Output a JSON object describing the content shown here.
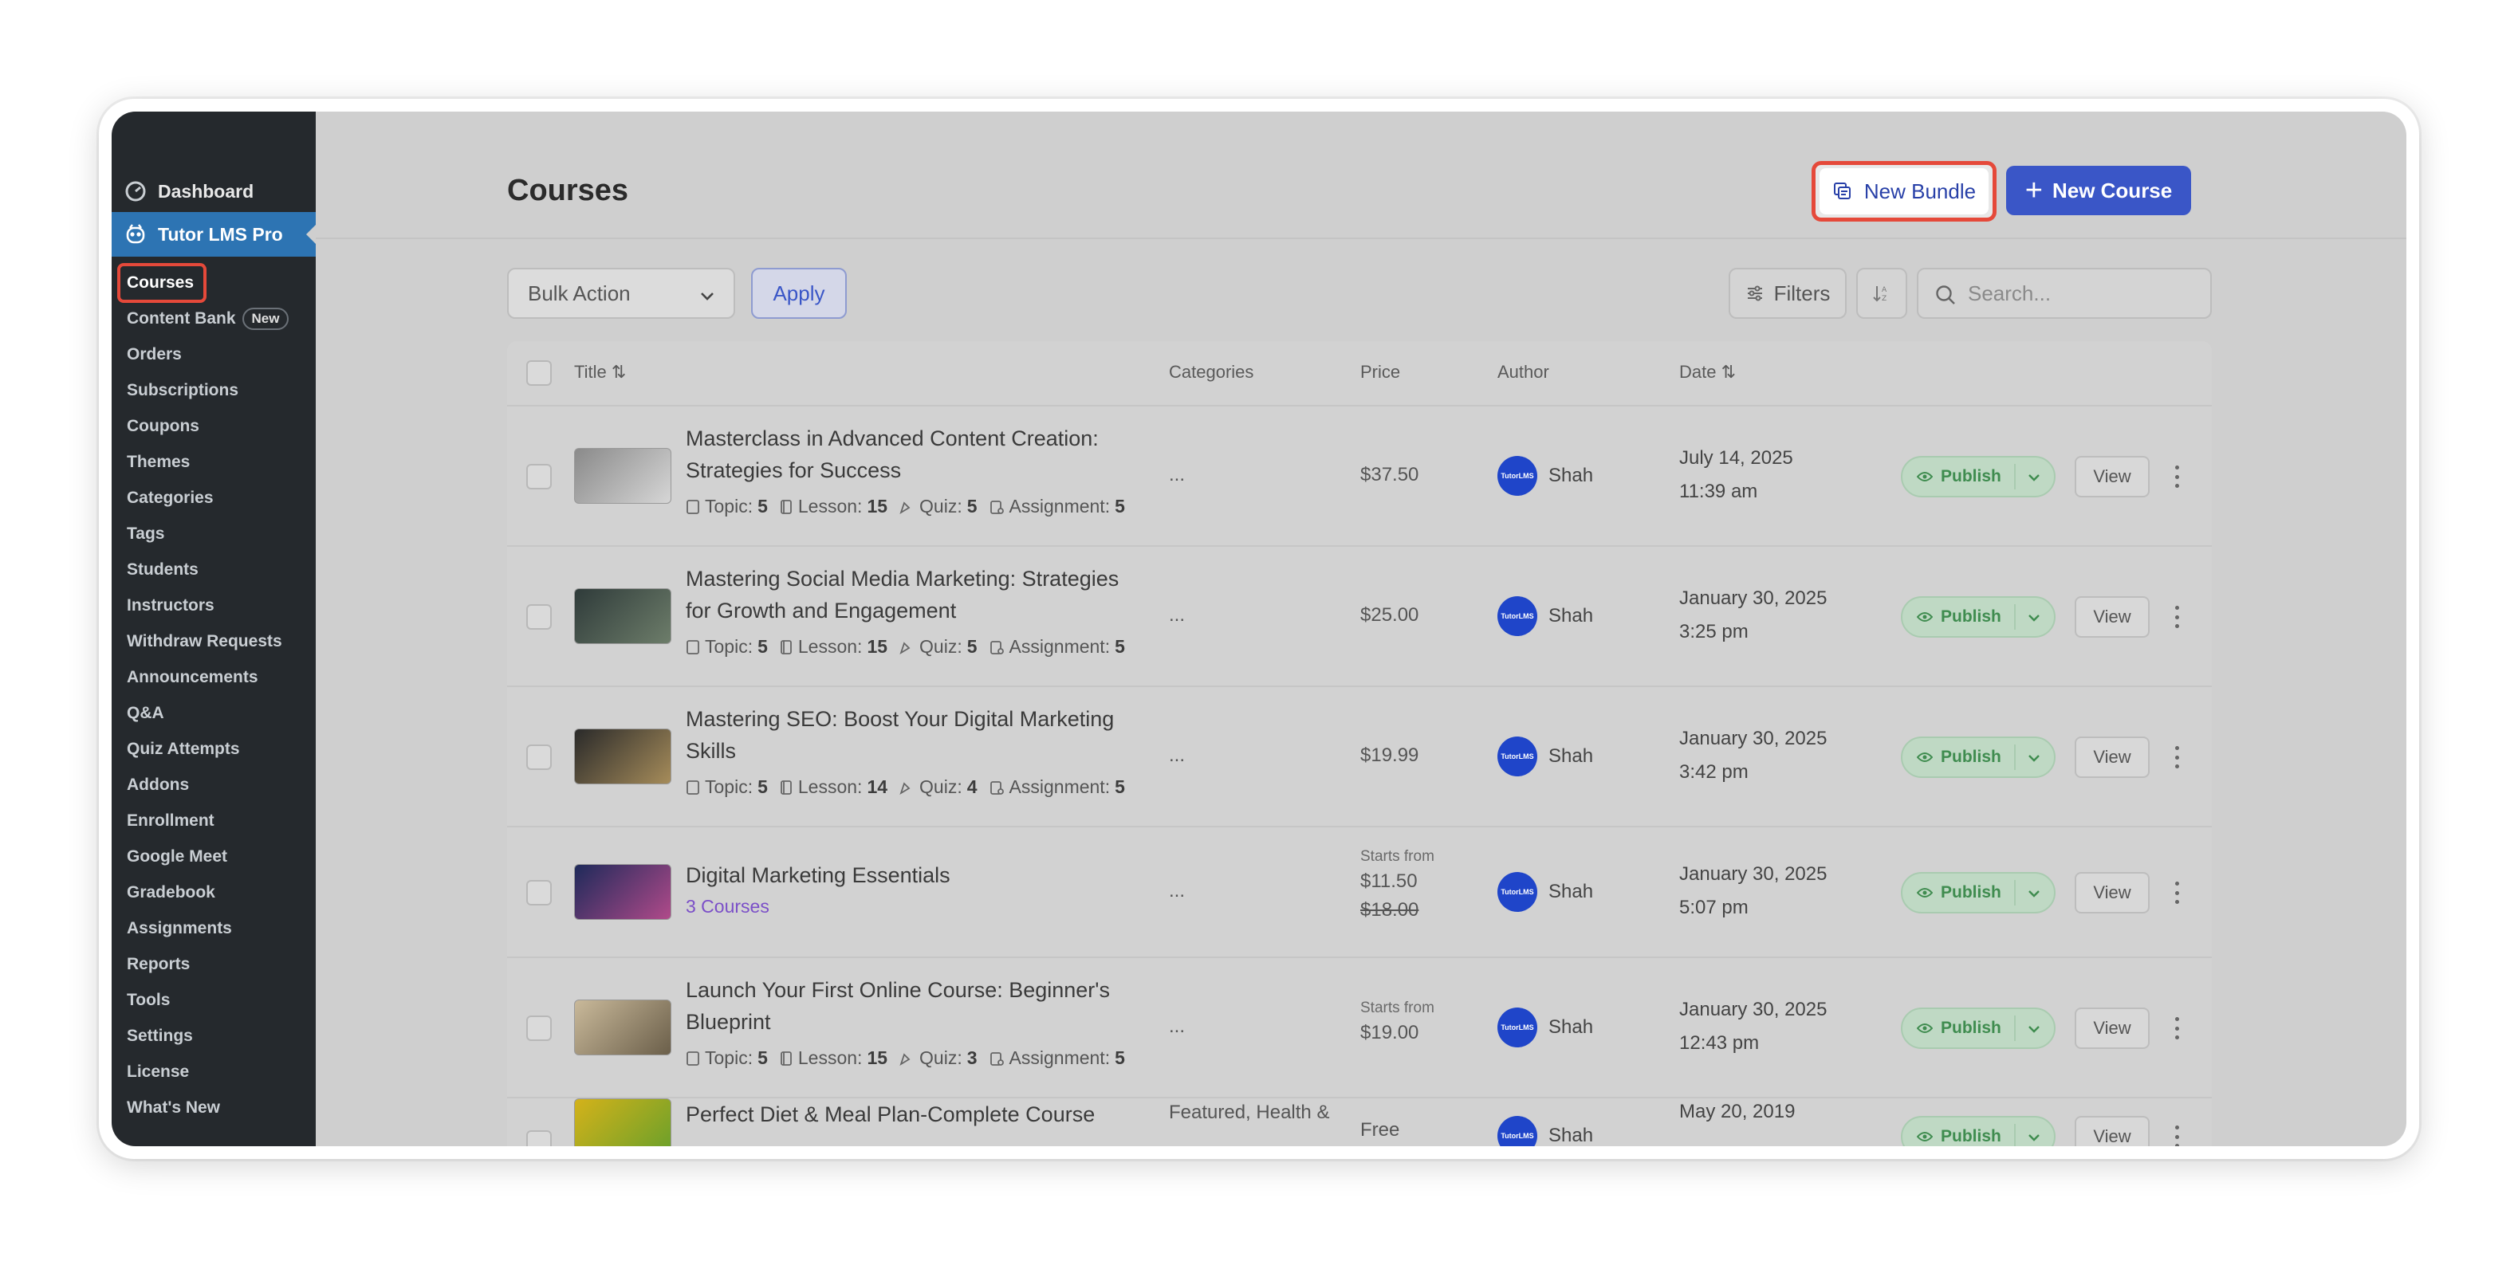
{
  "sidebar": {
    "dashboard": "Dashboard",
    "plugin": "Tutor LMS Pro",
    "items": [
      {
        "label": "Courses",
        "current": true
      },
      {
        "label": "Content Bank",
        "badge": "New"
      },
      {
        "label": "Orders"
      },
      {
        "label": "Subscriptions"
      },
      {
        "label": "Coupons"
      },
      {
        "label": "Themes"
      },
      {
        "label": "Categories"
      },
      {
        "label": "Tags"
      },
      {
        "label": "Students"
      },
      {
        "label": "Instructors"
      },
      {
        "label": "Withdraw Requests"
      },
      {
        "label": "Announcements"
      },
      {
        "label": "Q&A"
      },
      {
        "label": "Quiz Attempts"
      },
      {
        "label": "Addons"
      },
      {
        "label": "Enrollment"
      },
      {
        "label": "Google Meet"
      },
      {
        "label": "Gradebook"
      },
      {
        "label": "Assignments"
      },
      {
        "label": "Reports"
      },
      {
        "label": "Tools"
      },
      {
        "label": "Settings"
      },
      {
        "label": "License"
      },
      {
        "label": "What's New"
      }
    ]
  },
  "header": {
    "title": "Courses",
    "new_bundle": "New Bundle",
    "new_course": "New Course"
  },
  "toolbar": {
    "bulk_action": "Bulk Action",
    "apply": "Apply",
    "filters": "Filters",
    "search_placeholder": "Search..."
  },
  "table": {
    "headers": {
      "title": "Title",
      "categories": "Categories",
      "price": "Price",
      "author": "Author",
      "date": "Date"
    },
    "rows": [
      {
        "title_line1": "Masterclass in Advanced Content Creation:",
        "title_line2": "Strategies for Success",
        "topic": "5",
        "lesson": "15",
        "quiz": "5",
        "assignment": "5",
        "category": "...",
        "price": "$37.50",
        "author": "Shah",
        "date": "July 14, 2025",
        "time": "11:39 am",
        "status": "Publish",
        "view": "View",
        "thumb_colors": [
          "#8a8a8a",
          "#d6d6d6"
        ]
      },
      {
        "title_line1": "Mastering Social Media Marketing: Strategies",
        "title_line2": "for Growth and Engagement",
        "topic": "5",
        "lesson": "15",
        "quiz": "5",
        "assignment": "5",
        "category": "...",
        "price": "$25.00",
        "author": "Shah",
        "date": "January 30, 2025",
        "time": "3:25 pm",
        "status": "Publish",
        "view": "View",
        "thumb_colors": [
          "#2f3b3a",
          "#6d7d6a"
        ]
      },
      {
        "title_line1": "Mastering SEO: Boost Your Digital Marketing",
        "title_line2": "Skills",
        "topic": "5",
        "lesson": "14",
        "quiz": "4",
        "assignment": "5",
        "category": "...",
        "price": "$19.99",
        "author": "Shah",
        "date": "January 30, 2025",
        "time": "3:42 pm",
        "status": "Publish",
        "view": "View",
        "thumb_colors": [
          "#2a2a2a",
          "#a68c5a"
        ]
      },
      {
        "title_line1": "Digital Marketing Essentials",
        "bundle": "3 Courses",
        "category": "...",
        "price_label": "Starts from",
        "price": "$11.50",
        "price_old": "$18.00",
        "author": "Shah",
        "date": "January 30, 2025",
        "time": "5:07 pm",
        "status": "Publish",
        "view": "View",
        "thumb_colors": [
          "#1e2a5a",
          "#b04a8a"
        ]
      },
      {
        "title_line1": "Launch Your First Online Course: Beginner's",
        "title_line2": "Blueprint",
        "topic": "5",
        "lesson": "15",
        "quiz": "3",
        "assignment": "5",
        "category": "...",
        "price_label": "Starts from",
        "price": "$19.00",
        "author": "Shah",
        "date": "January 30, 2025",
        "time": "12:43 pm",
        "status": "Publish",
        "view": "View",
        "thumb_colors": [
          "#c9b99a",
          "#6b5f4a"
        ]
      },
      {
        "title_line1": "Perfect Diet & Meal Plan-Complete Course",
        "category": "Featured, Health &",
        "price": "Free",
        "author": "Shah",
        "date": "May 20, 2019",
        "status": "Publish",
        "view": "View",
        "thumb_colors": [
          "#d4b21a",
          "#6aa02a"
        ]
      }
    ],
    "meta_labels": {
      "topic": "Topic:",
      "lesson": "Lesson:",
      "quiz": "Quiz:",
      "assignment": "Assignment:"
    }
  },
  "colors": {
    "accent": "#3a56c7",
    "highlight": "#e5493a",
    "sidebar_bg": "#25292d",
    "sidebar_active": "#2d74b3",
    "publish_green": "#3f8c4f",
    "bundle_purple": "#7b4fc8"
  }
}
